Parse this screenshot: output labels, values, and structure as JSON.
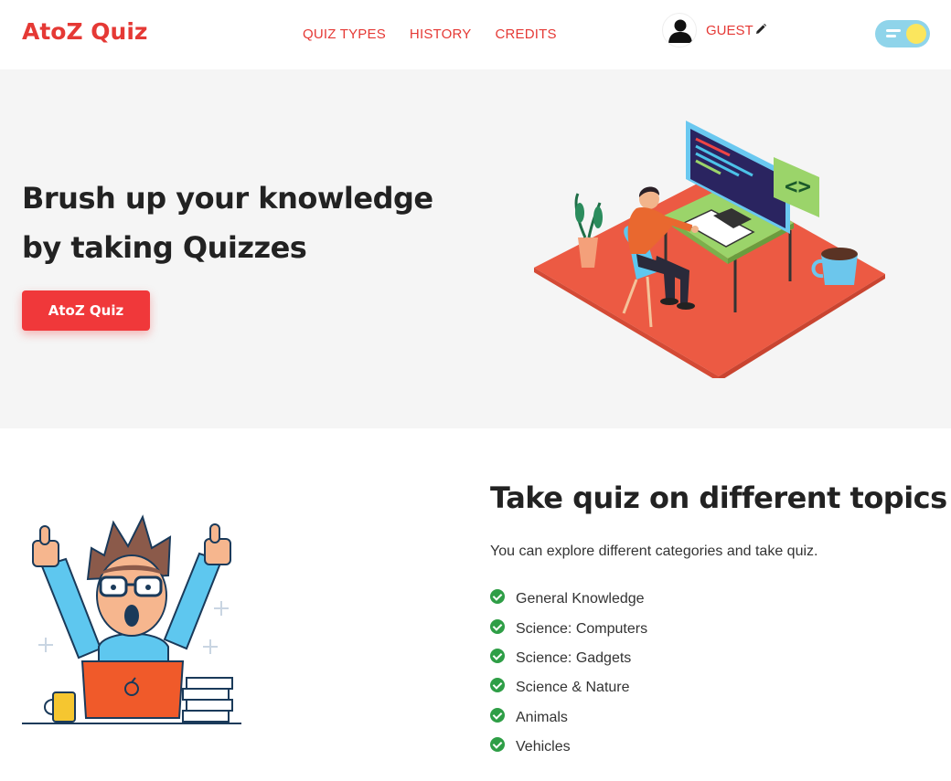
{
  "header": {
    "logo": "AtoZ Quiz",
    "nav": [
      {
        "label": "QUIZ TYPES"
      },
      {
        "label": "HISTORY"
      },
      {
        "label": "CREDITS"
      }
    ],
    "user_name": "GUEST",
    "theme_toggle": "light"
  },
  "hero": {
    "line1": "Brush up your knowledge",
    "line2_prefix": "by taking ",
    "line2_bold": "Quizzes",
    "cta_label": "AtoZ Quiz"
  },
  "topics": {
    "title": "Take quiz on different topics",
    "subtitle": "You can explore different categories and take quiz.",
    "items": [
      "General Knowledge",
      "Science: Computers",
      "Science: Gadgets",
      "Science & Nature",
      "Animals",
      "Vehicles"
    ]
  },
  "colors": {
    "accent": "#e53935",
    "button": "#f0383a",
    "check": "#2e9e46",
    "hero_bg": "#f5f5f5"
  }
}
